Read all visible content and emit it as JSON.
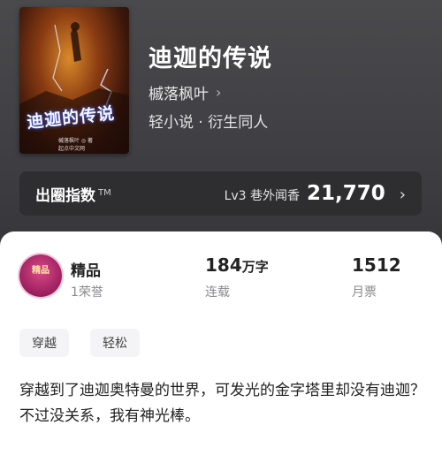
{
  "book": {
    "title": "迪迦的传说",
    "author": "槭落枫叶",
    "genre": "轻小说 · 衍生同人",
    "cover": {
      "title": "迪迦的传说",
      "author_line": "槭落枫叶 ◎ 著",
      "publisher_line": "起点中文网"
    }
  },
  "fan_index": {
    "label": "出圈指数",
    "tm": "TM",
    "level": "Lv3 巷外闻香",
    "value": "21,770"
  },
  "honor": {
    "badge_text": "精品",
    "title": "精品",
    "subtitle": "1荣誉"
  },
  "stats": {
    "words_value": "184",
    "words_unit": "万字",
    "status": "连载",
    "monthly_votes": "1512",
    "monthly_label": "月票"
  },
  "tags": [
    "穿越",
    "轻松"
  ],
  "description": [
    "穿越到了迪迦奥特曼的世界，可发光的金字塔里却没有迪迦？",
    "不过没关系，我有神光棒。"
  ],
  "colors": {
    "header_bg": "#404044",
    "sheet_bg": "#ffffff",
    "badge": "#9b1f5e"
  }
}
